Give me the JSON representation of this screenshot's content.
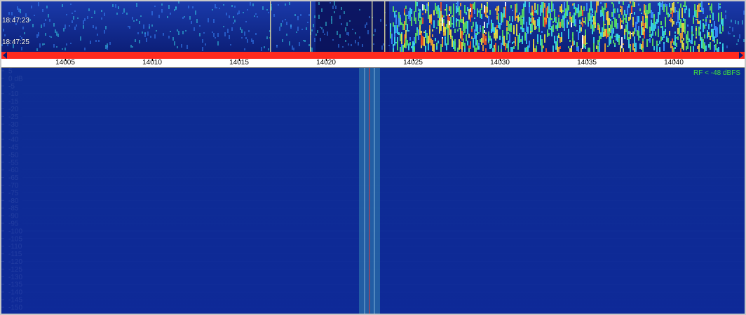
{
  "waterfall": {
    "timestamps": [
      "18:47:23",
      "18:47:25"
    ]
  },
  "frequency_axis": {
    "labels": [
      "14005",
      "14010",
      "14015",
      "14020",
      "14025",
      "14030",
      "14035",
      "14040"
    ]
  },
  "spectrum": {
    "db_labels": [
      "5",
      "0 dB",
      "-5",
      "-10",
      "-15",
      "-20",
      "-25",
      "-30",
      "-35",
      "-40",
      "-45",
      "-50",
      "-55",
      "-60",
      "-65",
      "-70",
      "-75",
      "-80",
      "-85",
      "-90",
      "-95",
      "-100",
      "-105",
      "-110",
      "-115",
      "-120",
      "-125",
      "-130",
      "-135",
      "-140",
      "-145",
      "-150"
    ],
    "rf_indicator": "RF < -48 dBFS",
    "passband_center_khz": 14022.5
  },
  "colors": {
    "background": "#0a1f7a",
    "spectrum_fill": "#1f7a1f",
    "trace": "#a0a0a0",
    "scale_bar": "#ff2a1e",
    "rf_text": "#3fe03f",
    "passband": "#2a6fa8"
  }
}
